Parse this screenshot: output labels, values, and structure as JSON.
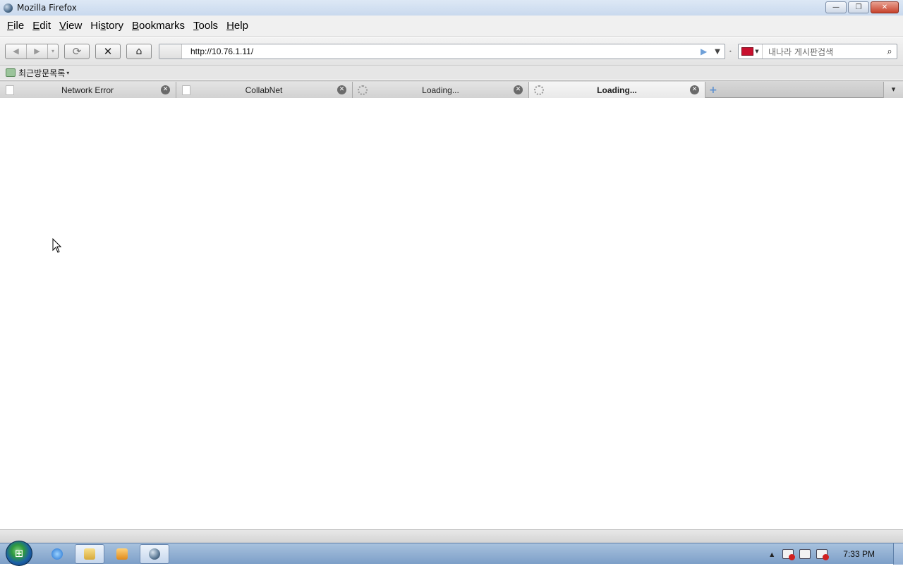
{
  "window": {
    "title": "Mozilla Firefox",
    "controls": {
      "minimize": "—",
      "maximize": "❐",
      "close": "✕"
    }
  },
  "menu": [
    {
      "key": "F",
      "rest": "ile"
    },
    {
      "key": "E",
      "rest": "dit"
    },
    {
      "key": "V",
      "rest": "iew"
    },
    {
      "key": "",
      "rest": "History",
      "pre": "Hi",
      "ul": "s",
      "post": "tory"
    },
    {
      "key": "B",
      "rest": "ookmarks"
    },
    {
      "key": "T",
      "rest": "ools"
    },
    {
      "key": "H",
      "rest": "elp"
    }
  ],
  "toolbar": {
    "back_icon": "◀",
    "forward_icon": "▶",
    "history_dropdown_icon": "▾",
    "reload_icon": "⟳",
    "stop_icon": "✕",
    "home_icon": "⌂"
  },
  "urlbar": {
    "url": "http://10.76.1.11/",
    "go_icon": "▶",
    "dropdown_icon": "▼"
  },
  "search": {
    "placeholder": "내나라 게시판검색",
    "engine_dropdown": "▼",
    "icon": "🔍"
  },
  "bookmarks": {
    "folder_label": "최근방문목록",
    "caret": "▾"
  },
  "tabs": [
    {
      "label": "Network Error",
      "state": "loaded",
      "selected": false
    },
    {
      "label": "CollabNet",
      "state": "loaded",
      "selected": false
    },
    {
      "label": "Loading...",
      "state": "loading",
      "selected": false
    },
    {
      "label": "Loading...",
      "state": "loading",
      "selected": true
    }
  ],
  "tab_close_icon": "✕",
  "new_tab_icon": "+",
  "all_tabs_icon": "▾",
  "taskbar": {
    "apps": [
      {
        "name": "internet-explorer",
        "active": false
      },
      {
        "name": "windows-explorer",
        "active": true
      },
      {
        "name": "media-player",
        "active": false
      },
      {
        "name": "firefox",
        "active": true
      }
    ],
    "tray_expand": "▲",
    "clock": "7:33 PM"
  },
  "colors": {
    "taskbar": "#8fadd3",
    "titlebar": "#c9d9ee",
    "close_button": "#c7422c",
    "search_engine_logo": "#c8102e"
  }
}
